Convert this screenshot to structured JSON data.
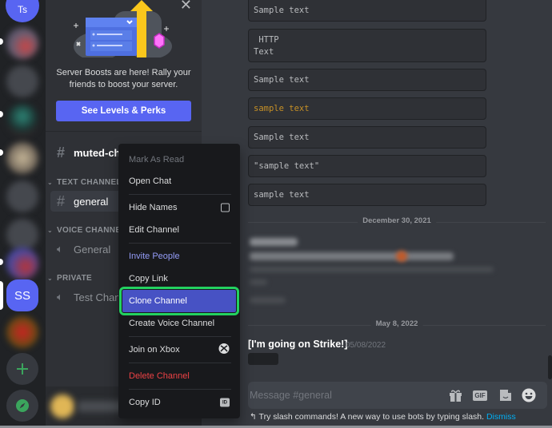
{
  "servers": {
    "top_server_initials": "Ts",
    "active_server_initials": "SS",
    "add_server_icon": "plus-icon",
    "explore_icon": "compass-icon"
  },
  "boost_banner": {
    "message": "Server Boosts are here! Rally your friends to boost your server.",
    "button_label": "See Levels & Perks",
    "close_icon": "close-icon"
  },
  "sidebar": {
    "muted_channel": "muted-cha",
    "categories": [
      {
        "name": "TEXT CHANNELS",
        "channels": [
          {
            "name": "general",
            "type": "text",
            "active": true
          }
        ]
      },
      {
        "name": "VOICE CHANNELS",
        "channels": [
          {
            "name": "General",
            "type": "voice"
          }
        ]
      },
      {
        "name": "PRIVATE",
        "channels": [
          {
            "name": "Test Chann",
            "type": "voice-locked"
          }
        ]
      }
    ]
  },
  "context_menu": {
    "items": [
      {
        "label": "Mark As Read",
        "state": "disabled"
      },
      {
        "label": "Open Chat"
      },
      {
        "label": "Hide Names",
        "right": "checkbox",
        "checked": false
      },
      {
        "label": "Edit Channel"
      },
      {
        "label": "Invite People",
        "style": "brand"
      },
      {
        "label": "Copy Link"
      },
      {
        "label": "Clone Channel",
        "state": "selected"
      },
      {
        "label": "Create Voice Channel"
      },
      {
        "label": "Join on Xbox",
        "right": "xbox-icon"
      },
      {
        "label": "Delete Channel",
        "style": "danger"
      },
      {
        "label": "Copy ID",
        "right": "id-badge",
        "badge_text": "ID"
      }
    ]
  },
  "chat": {
    "code_blocks": [
      {
        "text": "Sample text"
      },
      {
        "text": " HTTP\nText"
      },
      {
        "text": "Sample text"
      },
      {
        "text": "sample text",
        "style": "yellow"
      },
      {
        "text": "Sample text"
      },
      {
        "text": "\"sample text\""
      },
      {
        "text": "sample text"
      }
    ],
    "date_dividers": [
      "December 30, 2021",
      "May 8, 2022"
    ],
    "last_message": {
      "author": "[I'm going on Strike!]",
      "timestamp": "05/08/2022"
    },
    "input": {
      "placeholder": "Message #general",
      "icons": [
        "gift-icon",
        "gif-icon",
        "sticker-icon",
        "emoji-icon"
      ],
      "gif_label": "GIF"
    },
    "hint": {
      "text": "Try slash commands! A new way to use bots by typing slash.",
      "dismiss_label": "Dismiss"
    }
  },
  "colors": {
    "brand": "#5865f2",
    "selected_highlight": "#23d160",
    "danger": "#ed4245",
    "link": "#00aff4"
  }
}
